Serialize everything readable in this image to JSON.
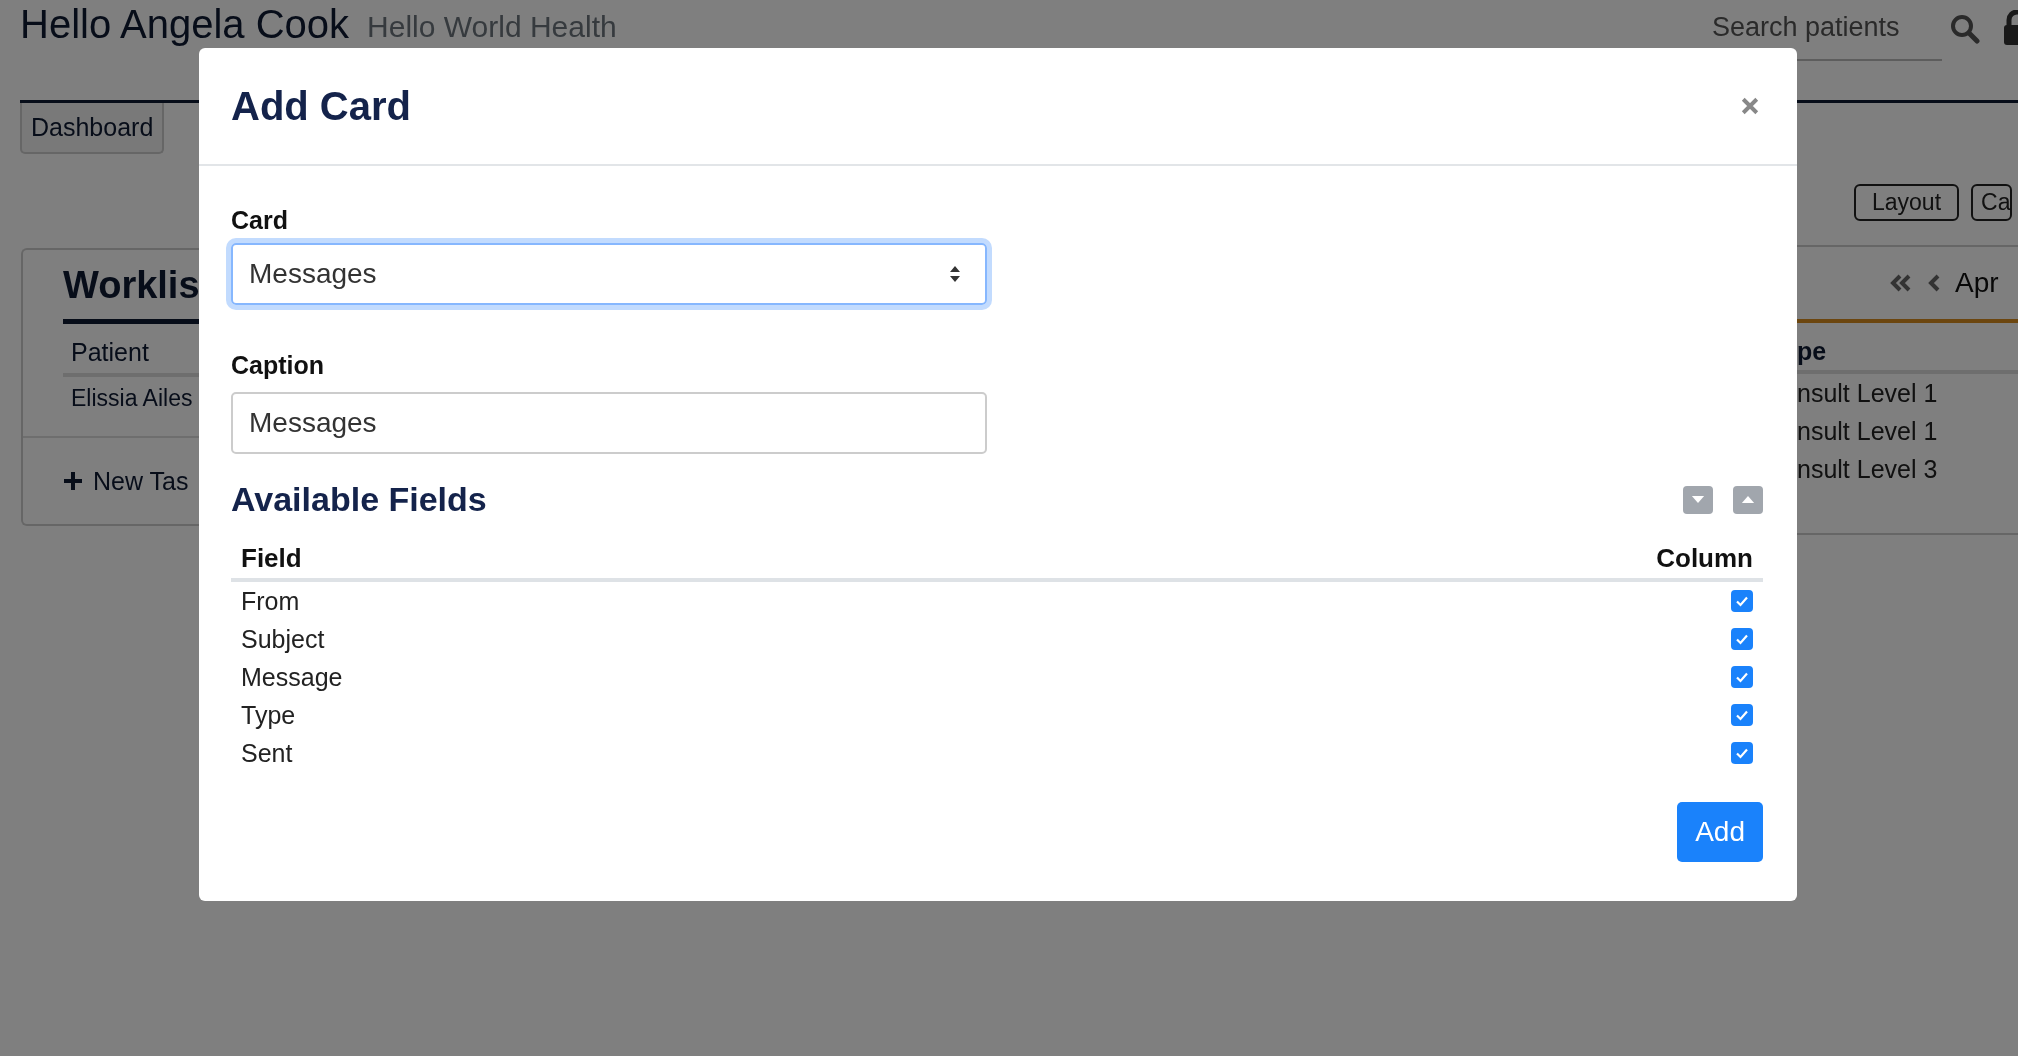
{
  "header": {
    "title": "Hello Angela Cook",
    "subtitle": "Hello World Health",
    "search": {
      "placeholder": "Search patients"
    }
  },
  "tabs": [
    {
      "label": "Dashboard",
      "selected": true
    }
  ],
  "toolbar": {
    "buttons": [
      "Layout",
      "Ca"
    ]
  },
  "worklist": {
    "title": "Worklis",
    "columns": [
      "Patient"
    ],
    "rows": [
      "Elissia Ailes"
    ],
    "new_task": "New Tas"
  },
  "schedule": {
    "month": "Apr",
    "columns": [
      "pe"
    ],
    "rows": [
      "nsult Level 1",
      "nsult Level 1",
      "nsult Level 3"
    ]
  },
  "modal": {
    "title": "Add Card",
    "card": {
      "label": "Card",
      "value": "Messages",
      "focused": true
    },
    "caption": {
      "label": "Caption",
      "value": "Messages"
    },
    "fields_title": "Available Fields",
    "columns": [
      "Field",
      "Column"
    ],
    "fields": [
      {
        "name": "From",
        "checked": true
      },
      {
        "name": "Subject",
        "checked": true
      },
      {
        "name": "Message",
        "checked": true
      },
      {
        "name": "Type",
        "checked": true
      },
      {
        "name": "Sent",
        "checked": true
      }
    ],
    "add_button": "Add"
  }
}
